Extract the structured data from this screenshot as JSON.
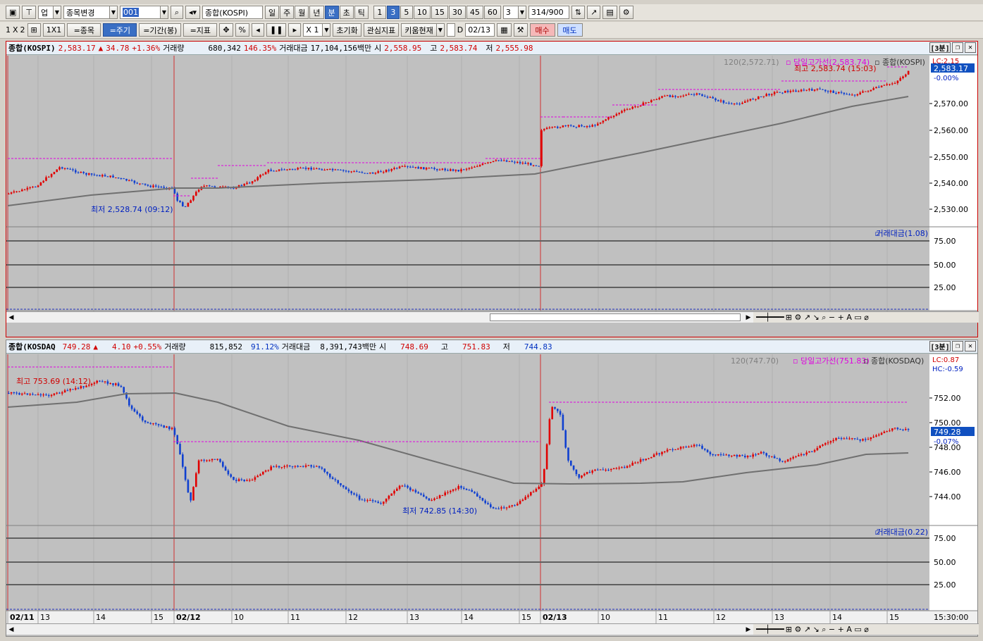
{
  "toolbar1": {
    "upjong": "업",
    "stock_change": "종목변경",
    "code": "001",
    "name": "종합(KOSPI)",
    "periods": [
      "일",
      "주",
      "월",
      "년",
      "분",
      "초",
      "틱"
    ],
    "active_period": "분",
    "minutes": [
      "1",
      "3",
      "5",
      "10",
      "15",
      "30",
      "45",
      "60"
    ],
    "active_minute": "3",
    "min_input": "3",
    "count_current": "314",
    "count_total": "/900"
  },
  "toolbar2": {
    "layout1": "1",
    "layout_x": "X",
    "layout2": "2",
    "ratio": "1X1",
    "btn_stock": "=종목",
    "btn_cycle": "=주기",
    "btn_period": "=기간(봉)",
    "btn_indicator": "=지표",
    "percent": "%",
    "zoom": "X 1",
    "reset": "초기화",
    "watch": "관심지표",
    "kiwoom": "키움현재",
    "d_label": "D",
    "date": "02/13",
    "buy": "매수",
    "sell": "매도"
  },
  "kospi": {
    "name": "종합(KOSPI)",
    "price": "2,583.17",
    "arrow": "▲",
    "change": "34.78",
    "pct": "+1.36%",
    "vol_label": "거래량",
    "volume": "680,342",
    "vol_pct": "146.35%",
    "amt_label": "거래대금",
    "amount": "17,104,156백만",
    "open_label": "시",
    "open": "2,558.95",
    "high_label": "고",
    "high": "2,583.74",
    "low_label": "저",
    "low": "2,555.98",
    "timeframe": "[3분]",
    "legend_ma": "120(2,572.71)",
    "legend_high": "당일고가선(2,583.74)",
    "legend_name": "종합(KOSPI)",
    "lc": "LC:2.15",
    "cur_box": "2,583.17",
    "cur_pct": "-0.00%",
    "high_ann": "최고 2,583.74 (15:03)",
    "low_ann": "최저 2,528.74 (09:12)",
    "y_labels": [
      "2,570.00",
      "2,560.00",
      "2,550.00",
      "2,540.00",
      "2,530.00"
    ],
    "sub_label": "거래대금(1.08)",
    "sub_y": [
      "75.00",
      "50.00",
      "25.00"
    ],
    "x_labels": [
      {
        "t": "02/11",
        "b": true
      },
      {
        "t": "13",
        "b": false
      },
      {
        "t": "14",
        "b": false
      },
      {
        "t": "15",
        "b": false
      },
      {
        "t": "02/12",
        "b": true
      },
      {
        "t": "10",
        "b": false
      },
      {
        "t": "11",
        "b": false
      },
      {
        "t": "12",
        "b": false
      },
      {
        "t": "13",
        "b": false
      },
      {
        "t": "14",
        "b": false
      },
      {
        "t": "15",
        "b": false
      },
      {
        "t": "02/13",
        "b": true
      },
      {
        "t": "10",
        "b": false
      },
      {
        "t": "11",
        "b": false
      },
      {
        "t": "12",
        "b": false
      },
      {
        "t": "13",
        "b": false
      },
      {
        "t": "14",
        "b": false
      },
      {
        "t": "15",
        "b": false
      }
    ],
    "end_time": "15:30:00"
  },
  "kosdaq": {
    "name": "종합(KOSDAQ",
    "price": "749.28",
    "arrow": "▲",
    "change": "4.10",
    "pct": "+0.55%",
    "vol_label": "거래량",
    "volume": "815,852",
    "vol_pct": "91.12%",
    "amt_label": "거래대금",
    "amount": "8,391,743백만",
    "open_label": "시",
    "open": "748.69",
    "high_label": "고",
    "high": "751.83",
    "low_label": "저",
    "low": "744.83",
    "timeframe": "[3분]",
    "legend_ma": "120(747.70)",
    "legend_high": "당일고가선(751.83)",
    "legend_name": "종합(KOSDAQ)",
    "lc": "LC:0.87",
    "hc": "HC:-0.59",
    "cur_box": "749.28",
    "cur_pct": "-0.07%",
    "high_ann": "최고 753.69 (14:12)",
    "low_ann": "최저 742.85 (14:30)",
    "y_labels": [
      "752.00",
      "750.00",
      "748.00",
      "746.00",
      "744.00"
    ],
    "sub_label": "거래대금(0.22)",
    "sub_y": [
      "75.00",
      "50.00",
      "25.00"
    ],
    "x_labels": [
      {
        "t": "02/11",
        "b": true
      },
      {
        "t": "13",
        "b": false
      },
      {
        "t": "14",
        "b": false
      },
      {
        "t": "15",
        "b": false
      },
      {
        "t": "02/12",
        "b": true
      },
      {
        "t": "10",
        "b": false
      },
      {
        "t": "11",
        "b": false
      },
      {
        "t": "12",
        "b": false
      },
      {
        "t": "13",
        "b": false
      },
      {
        "t": "14",
        "b": false
      },
      {
        "t": "15",
        "b": false
      },
      {
        "t": "02/13",
        "b": true
      },
      {
        "t": "10",
        "b": false
      },
      {
        "t": "11",
        "b": false
      },
      {
        "t": "12",
        "b": false
      },
      {
        "t": "13",
        "b": false
      },
      {
        "t": "14",
        "b": false
      },
      {
        "t": "15",
        "b": false
      }
    ],
    "end_time": "15:30:00"
  },
  "colors": {
    "up": "#e00000",
    "down": "#1040d0",
    "ma": "#707070",
    "highline": "#e000e0",
    "bg": "#c0c0c0"
  }
}
